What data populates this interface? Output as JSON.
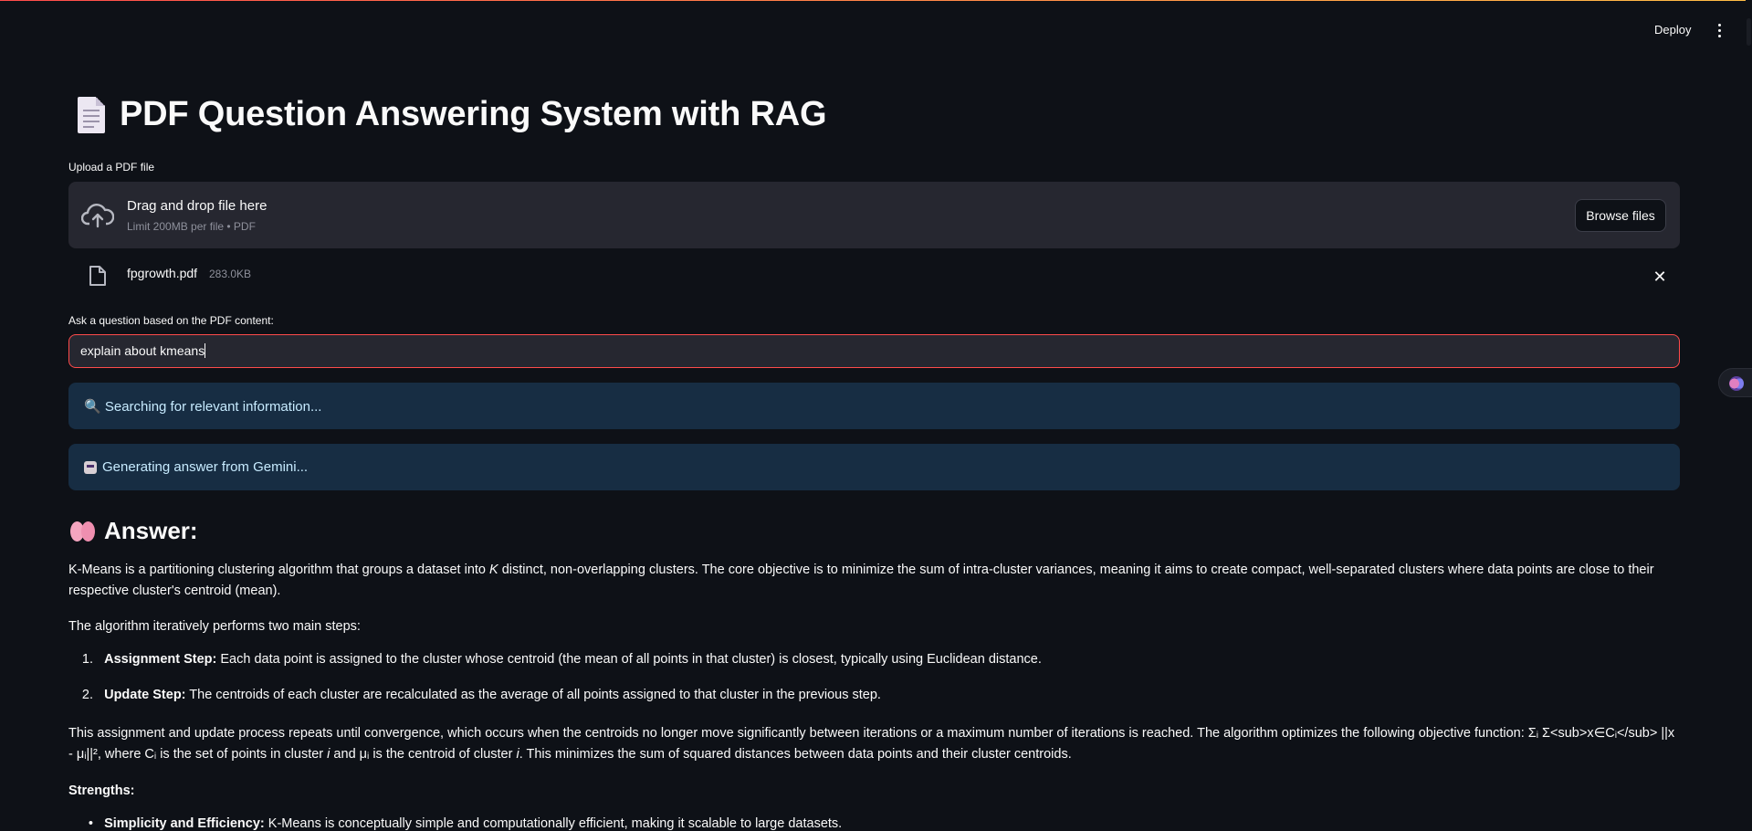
{
  "header": {
    "deploy_label": "Deploy",
    "menu_icon": "kebab-menu-icon"
  },
  "page": {
    "title_icon": "page-facing-up-icon",
    "title": "PDF Question Answering System with RAG"
  },
  "uploader": {
    "label": "Upload a PDF file",
    "icon": "cloud-upload-icon",
    "drop_text": "Drag and drop file here",
    "limit_text": "Limit 200MB per file • PDF",
    "browse_label": "Browse files"
  },
  "file": {
    "icon": "file-icon",
    "name": "fpgrowth.pdf",
    "size": "283.0KB",
    "remove_icon": "close-icon"
  },
  "question": {
    "label": "Ask a question based on the PDF content:",
    "value": "explain about kmeans"
  },
  "status": {
    "searching": "🔍 Searching for relevant information...",
    "generating": "Generating answer from Gemini..."
  },
  "answer": {
    "heading": "Answer:",
    "heading_icon": "brain-icon",
    "p1a": "K-Means is a partitioning clustering algorithm that groups a dataset into ",
    "p1k": "K",
    "p1b": " distinct, non-overlapping clusters. The core objective is to minimize the sum of intra-cluster variances, meaning it aims to create compact, well-separated clusters where data points are close to their respective cluster's centroid (mean).",
    "p2": "The algorithm iteratively performs two main steps:",
    "steps": [
      {
        "num": "1.",
        "bold": "Assignment Step:",
        "text": " Each data point is assigned to the cluster whose centroid (the mean of all points in that cluster) is closest, typically using Euclidean distance."
      },
      {
        "num": "2.",
        "bold": "Update Step:",
        "text": " The centroids of each cluster are recalculated as the average of all points assigned to that cluster in the previous step."
      }
    ],
    "p3a": "This assignment and update process repeats until convergence, which occurs when the centroids no longer move significantly between iterations or a maximum number of iterations is reached. The algorithm optimizes the following objective function: Σᵢ Σ<sub>x∈Cᵢ</sub> ||x - μᵢ||², where Cᵢ is the set of points in cluster ",
    "p3i1": "i",
    "p3b": " and μᵢ is the centroid of cluster ",
    "p3i2": "i",
    "p3c": ". This minimizes the sum of squared distances between data points and their cluster centroids.",
    "strengths_label": "Strengths:",
    "bullet_bold": "Simplicity and Efficiency:",
    "bullet_text": " K-Means is conceptually simple and computationally efficient, making it scalable to large datasets."
  }
}
